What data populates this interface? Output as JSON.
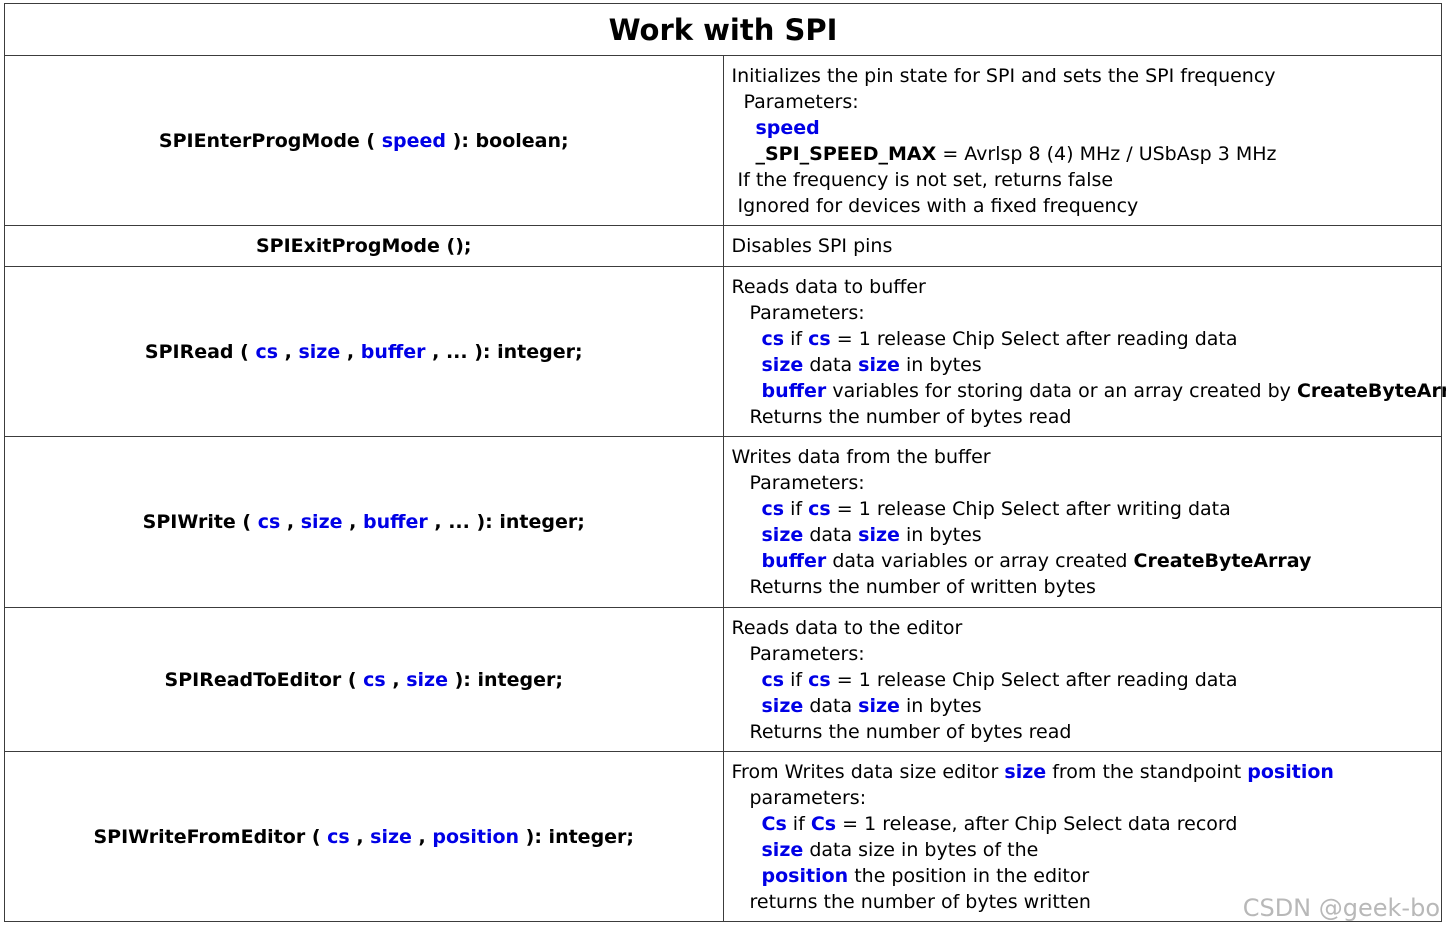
{
  "title": "Work with SPI",
  "rows": [
    {
      "func": [
        "SPIEnterProgMode",
        " ( ",
        "speed",
        " ): boolean;"
      ],
      "lines": [
        [
          "Initializes the pin state for SPI and sets the SPI frequency"
        ],
        [
          "Parameters:"
        ],
        [
          "speed"
        ],
        [
          "_SPI_SPEED_MAX",
          " = Avrlsp 8 (4) MHz / USbAsp 3 MHz"
        ],
        [
          "If the frequency is not set, returns false"
        ],
        [
          "Ignored for devices with a fixed frequency"
        ]
      ]
    },
    {
      "func": [
        "SPIExitProgMode ();"
      ],
      "lines": [
        [
          "Disables SPI pins"
        ]
      ]
    },
    {
      "func": [
        "SPIRead",
        " ( ",
        "cs",
        " , ",
        "size",
        " , ",
        "buffer",
        " , ... ): integer;"
      ],
      "lines": [
        [
          "Reads data to buffer"
        ],
        [
          "Parameters:"
        ],
        [
          "cs",
          " if ",
          "cs",
          " = 1 release Chip Select after reading data"
        ],
        [
          "size",
          " data ",
          "size",
          " in bytes"
        ],
        [
          "buffer",
          " variables for storing data or an array created by ",
          "CreateByteArray"
        ],
        [
          "Returns the number of bytes read"
        ]
      ]
    },
    {
      "func": [
        "SPIWrite",
        " ( ",
        "cs",
        " , ",
        "size",
        " , ",
        "buffer",
        " , ... ): integer;"
      ],
      "lines": [
        [
          "Writes data from the buffer"
        ],
        [
          "Parameters:"
        ],
        [
          "cs",
          " if ",
          "cs",
          " = 1 release Chip Select after writing data"
        ],
        [
          "size",
          " data ",
          "size",
          " in bytes"
        ],
        [
          "buffer",
          " data variables or array created ",
          "CreateByteArray"
        ],
        [
          "Returns the number of written bytes"
        ]
      ]
    },
    {
      "func": [
        "SPIReadToEditor",
        " ( ",
        "cs",
        " , ",
        "size",
        " ): integer;"
      ],
      "lines": [
        [
          "Reads data to the editor"
        ],
        [
          "Parameters:"
        ],
        [
          "cs",
          " if ",
          "cs",
          " = 1 release Chip Select after reading data"
        ],
        [
          "size",
          " data ",
          "size",
          " in bytes"
        ],
        [
          "Returns the number of bytes read"
        ]
      ]
    },
    {
      "func": [
        "SPIWriteFromEditor",
        " ( ",
        "cs",
        " , ",
        "size",
        " , ",
        "position",
        " ): integer;"
      ],
      "lines": [
        [
          "From Writes data size editor ",
          "size",
          " from the standpoint ",
          "position"
        ],
        [
          "parameters:"
        ],
        [
          "Cs",
          " if ",
          "Cs",
          " = 1 release, after Chip Select data record"
        ],
        [
          "size",
          " data size in bytes of the"
        ],
        [
          "position",
          " the position in the editor"
        ],
        [
          "returns the number of bytes written"
        ]
      ]
    }
  ],
  "watermark": "CSDN @geek-bo",
  "colors": {
    "keyword": "#0000e6",
    "border": "#3c3c3c",
    "text": "#000000"
  }
}
